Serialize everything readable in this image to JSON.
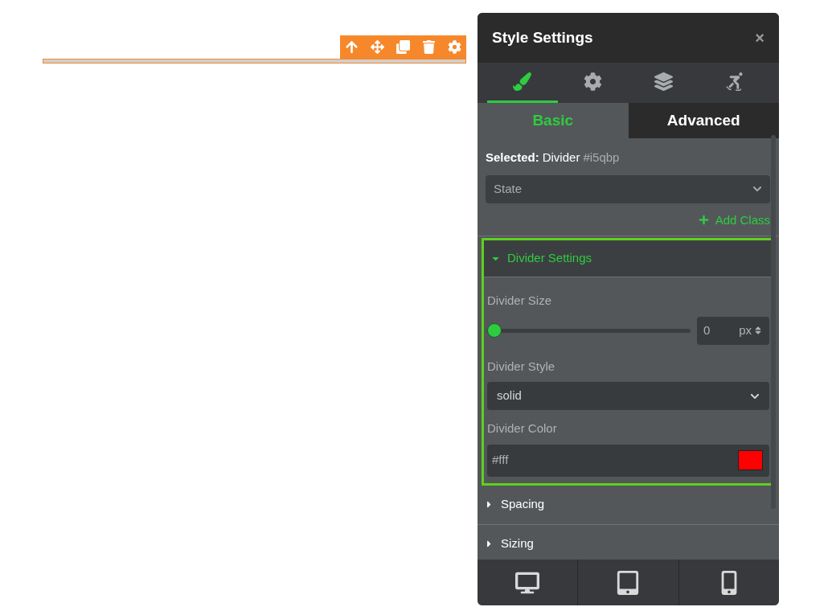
{
  "canvas": {
    "toolbar": [
      {
        "kind": "up"
      },
      {
        "kind": "move"
      },
      {
        "kind": "clone"
      },
      {
        "kind": "delete"
      },
      {
        "kind": "settings"
      }
    ]
  },
  "panel": {
    "title": "Style Settings",
    "close": "×",
    "icon_tabs": [
      {
        "kind": "style",
        "selected": true
      },
      {
        "kind": "settings",
        "selected": false
      },
      {
        "kind": "layers",
        "selected": false
      },
      {
        "kind": "animation",
        "selected": false
      }
    ],
    "sub_tabs": [
      {
        "label": "Basic",
        "selected": true
      },
      {
        "label": "Advanced",
        "selected": false
      }
    ],
    "selected": {
      "label": "Selected:",
      "name": "Divider",
      "id": "#i5qbp"
    },
    "state_select": {
      "placeholder": "State"
    },
    "add_class": "Add Class",
    "sections": [
      {
        "title": "Divider Settings",
        "expanded": true,
        "fields": [
          {
            "kind": "slider",
            "label": "Divider Size",
            "level": 0,
            "value": "0",
            "unit": "px"
          },
          {
            "kind": "select",
            "label": "Divider Style",
            "value": "solid"
          },
          {
            "kind": "color",
            "label": "Divider Color",
            "value": "#fff",
            "color": "#ff0000"
          }
        ]
      },
      {
        "title": "Spacing",
        "expanded": false
      },
      {
        "title": "Sizing",
        "expanded": false
      }
    ],
    "devices": [
      {
        "kind": "desktop"
      },
      {
        "kind": "tablet"
      },
      {
        "kind": "mobile"
      }
    ]
  }
}
